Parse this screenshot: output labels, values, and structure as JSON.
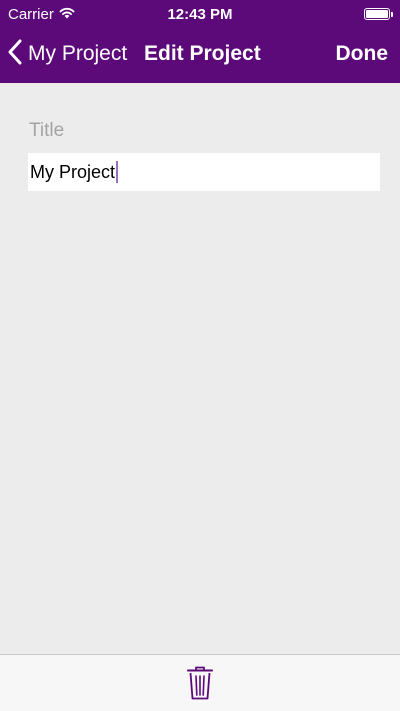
{
  "status_bar": {
    "carrier": "Carrier",
    "time": "12:43 PM"
  },
  "nav": {
    "back_label": "My Project",
    "title": "Edit Project",
    "done_label": "Done"
  },
  "form": {
    "title_label": "Title",
    "title_value": "My Project"
  },
  "icons": {
    "back": "chevron-left-icon",
    "wifi": "wifi-icon",
    "battery": "battery-icon",
    "delete": "trash-icon"
  },
  "colors": {
    "header": "#5c0a7a",
    "accent": "#5c0a7a",
    "background": "#ececec"
  }
}
